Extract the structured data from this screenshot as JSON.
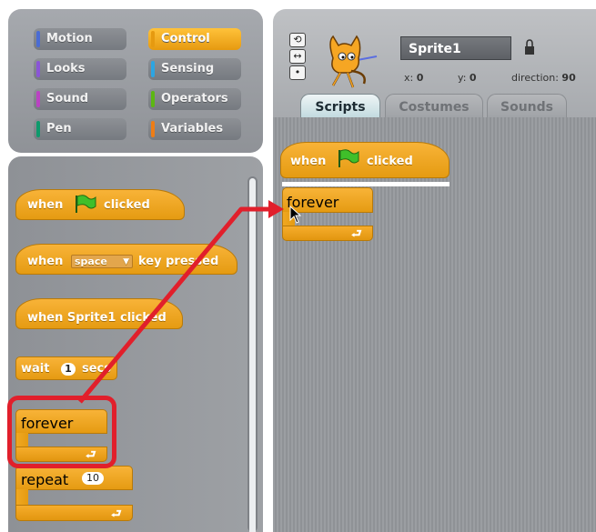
{
  "categories": [
    {
      "label": "Motion",
      "color": "#4a6cd4",
      "selected": false
    },
    {
      "label": "Control",
      "color": "#e1a91a",
      "selected": true
    },
    {
      "label": "Looks",
      "color": "#8a55d7",
      "selected": false
    },
    {
      "label": "Sensing",
      "color": "#2ca5e2",
      "selected": false
    },
    {
      "label": "Sound",
      "color": "#bb42c3",
      "selected": false
    },
    {
      "label": "Operators",
      "color": "#5cb712",
      "selected": false
    },
    {
      "label": "Pen",
      "color": "#0e9a6c",
      "selected": false
    },
    {
      "label": "Variables",
      "color": "#ee7d16",
      "selected": false
    }
  ],
  "palette": {
    "when_flag": {
      "prefix": "when",
      "suffix": "clicked"
    },
    "when_key": {
      "prefix": "when",
      "key": "space",
      "suffix": "key pressed"
    },
    "when_sprite": {
      "label": "when Sprite1 clicked"
    },
    "wait": {
      "prefix": "wait",
      "value": "1",
      "suffix": "secs"
    },
    "forever": {
      "label": "forever"
    },
    "repeat": {
      "prefix": "repeat",
      "value": "10"
    }
  },
  "sprite": {
    "name": "Sprite1",
    "x_label": "x:",
    "x_value": "0",
    "y_label": "y:",
    "y_value": "0",
    "direction_label": "direction:",
    "direction_value": "90"
  },
  "tabs": [
    {
      "label": "Scripts",
      "active": true
    },
    {
      "label": "Costumes",
      "active": false
    },
    {
      "label": "Sounds",
      "active": false
    }
  ],
  "script": {
    "when_flag": {
      "prefix": "when",
      "suffix": "clicked"
    },
    "forever": {
      "label": "forever"
    }
  },
  "colors": {
    "control": "#e59b12",
    "highlight": "#e11f2b"
  }
}
